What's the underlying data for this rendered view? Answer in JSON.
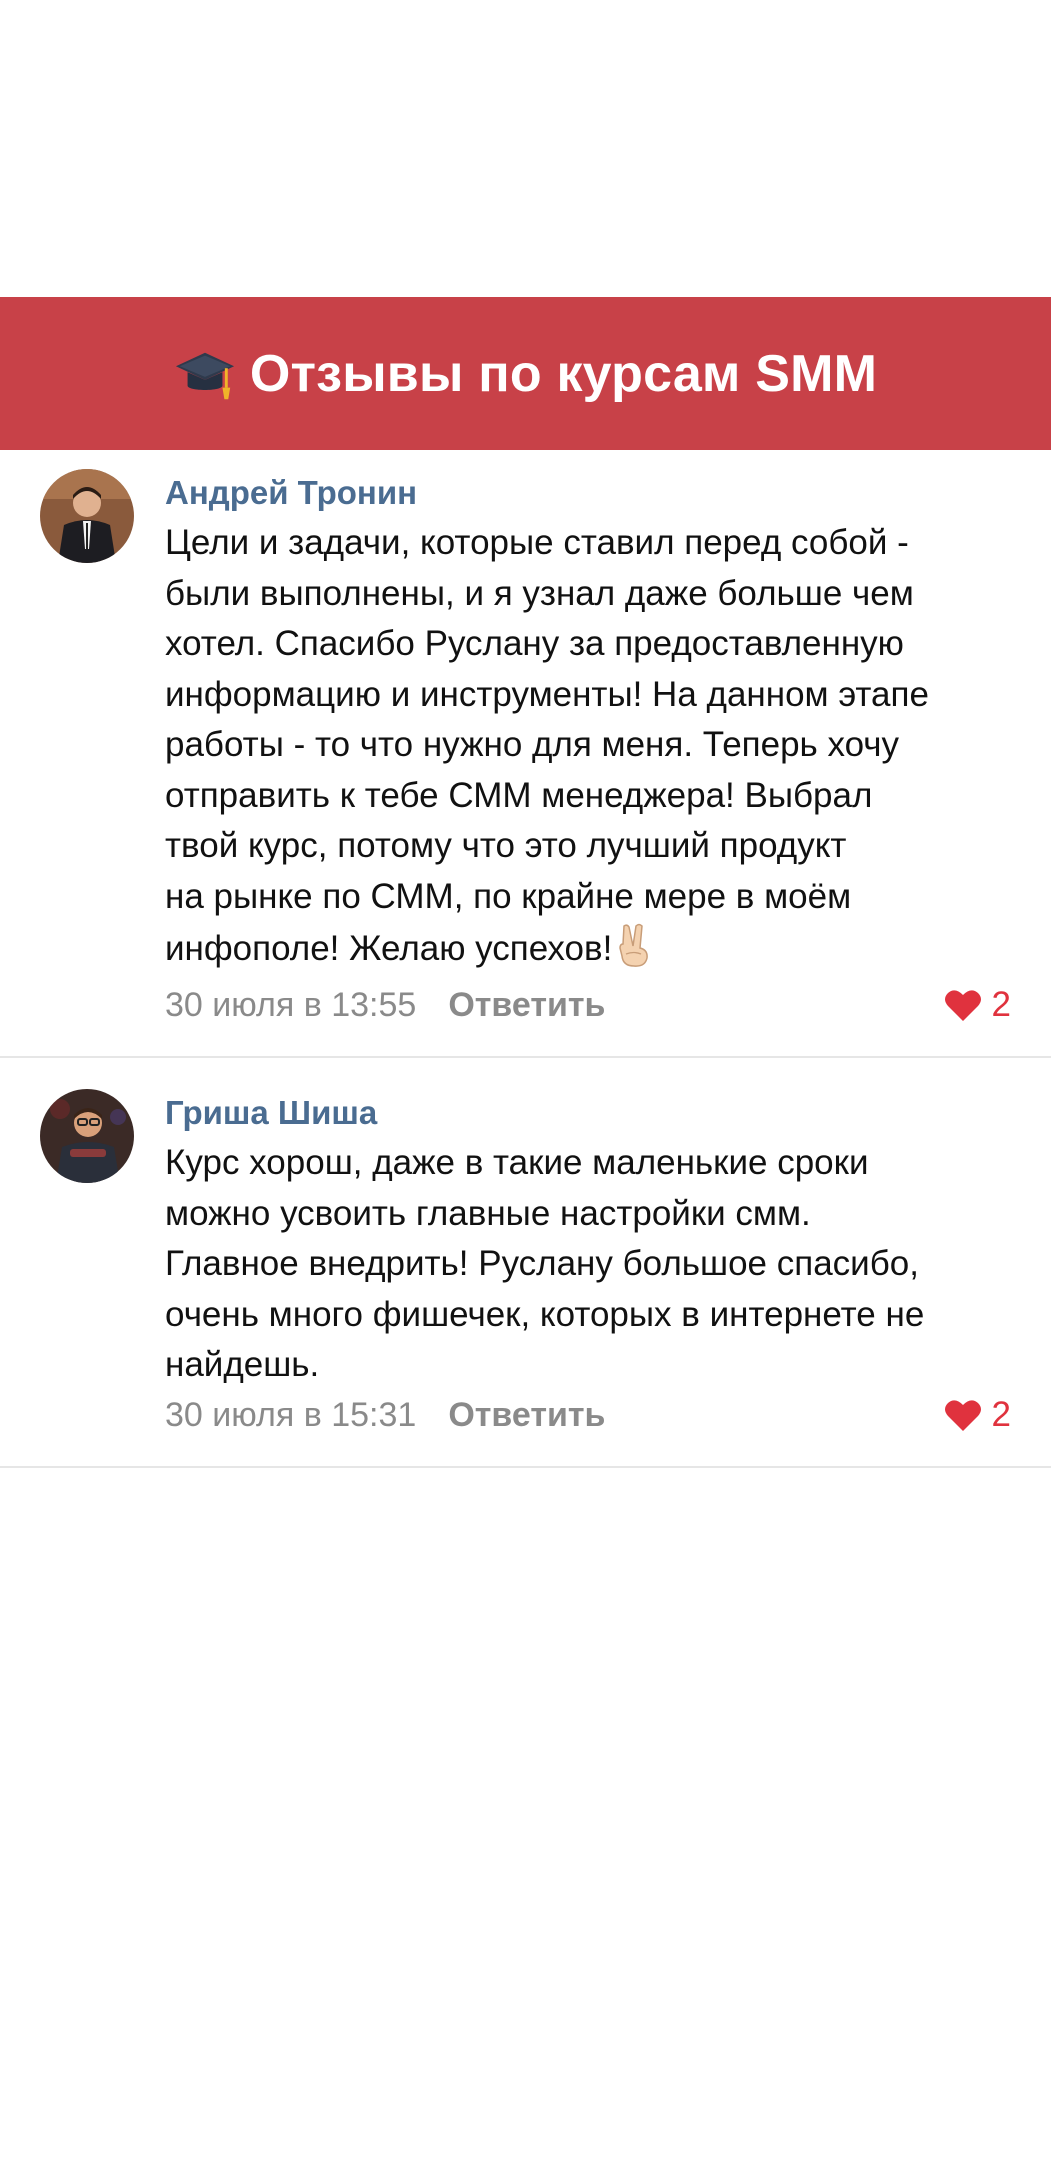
{
  "header": {
    "icon": "graduation-cap-icon",
    "title": "Отзывы по курсам SMM",
    "background": "#c84148"
  },
  "comments": [
    {
      "author": "Андрей Тронин",
      "text": "Цели и задачи, которые ставил перед собой -\nбыли выполнены, и я узнал даже больше чем\nхотел. Спасибо Руслану за предоставленную\nинформацию и инструменты! На данном этапе\nработы - то что нужно для меня. Теперь хочу\nотправить к тебе СММ менеджера! Выбрал\nтвой курс, потому что это лучший продукт\nна рынке по СММ, по крайне мере в моём\nинфополе! Желаю успехов!",
      "emoji": "victory-hand-icon",
      "time": "30 июля в 13:55",
      "reply": "Ответить",
      "likes": "2"
    },
    {
      "author": "Гриша Шиша",
      "text": "Курс хорош, даже в такие маленькие сроки\nможно усвоить главные настройки смм.\nГлавное внедрить! Руслану большое спасибо,\nочень много фишечек, которых в интернете не\nнайдешь.",
      "time": "30 июля в 15:31",
      "reply": "Ответить",
      "likes": "2"
    }
  ],
  "colors": {
    "author": "#4a6c91",
    "meta": "#8a8a8a",
    "like": "#e0323e",
    "divider": "#e6e6e6"
  }
}
